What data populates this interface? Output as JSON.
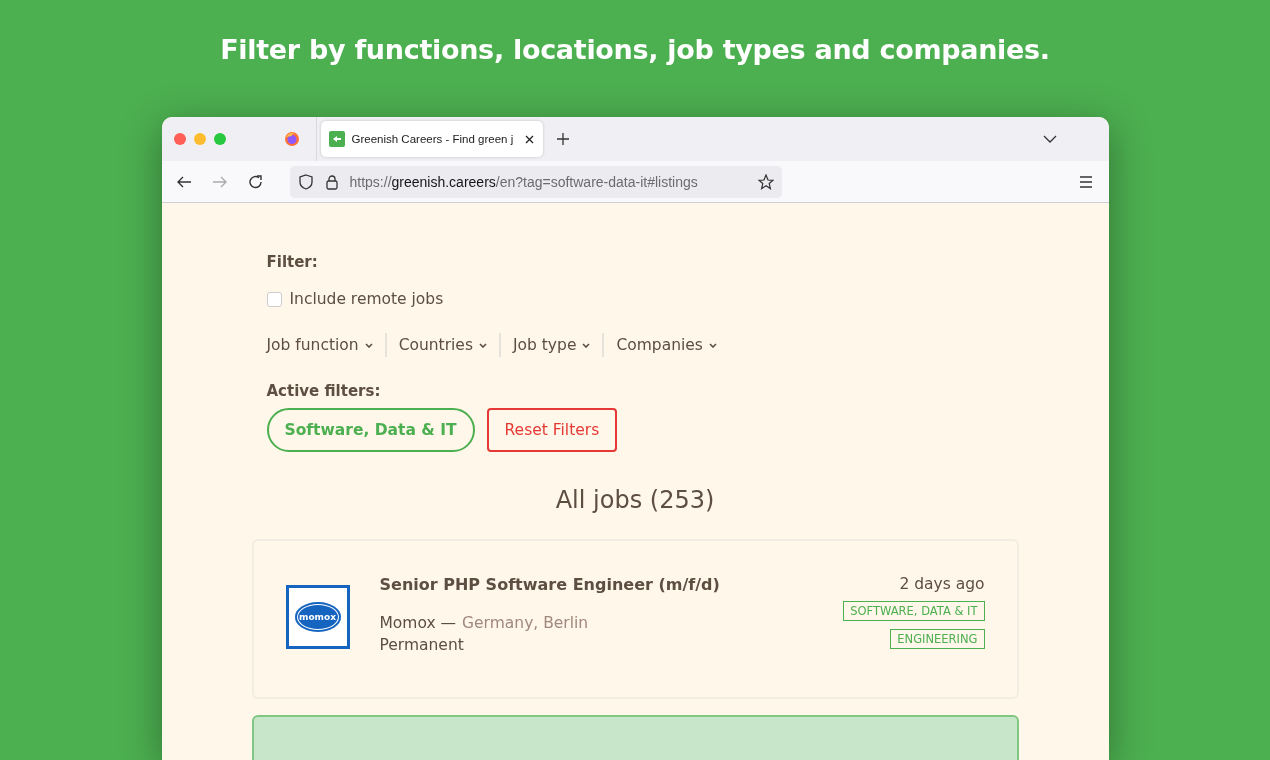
{
  "headline": "Filter by functions, locations, job types and companies.",
  "browser": {
    "tab": {
      "title": "Greenish Careers - Find green j",
      "selected": true
    },
    "url": "https://**greenish.careers**/en?tag=software-data-it#listings"
  },
  "filter": {
    "label": "Filter:",
    "remote": {
      "label": "Include remote jobs",
      "checked": false
    },
    "dropdowns": [
      "Job function",
      "Countries",
      "Job type",
      "Companies"
    ],
    "active_label": "Active filters:",
    "active": [
      "Software, Data & IT"
    ],
    "reset": "Reset Filters"
  },
  "listing_title": "All jobs (253)",
  "jobs": [
    {
      "featured": false,
      "logo_text": "momox",
      "title": "Senior PHP Software Engineer (m/f/d)",
      "company": "Momox —",
      "location": "Germany, Berlin",
      "type": "Permanent",
      "age": "2 days ago",
      "tags": [
        "SOFTWARE, DATA & IT",
        "ENGINEERING"
      ]
    },
    {
      "featured": true
    }
  ]
}
